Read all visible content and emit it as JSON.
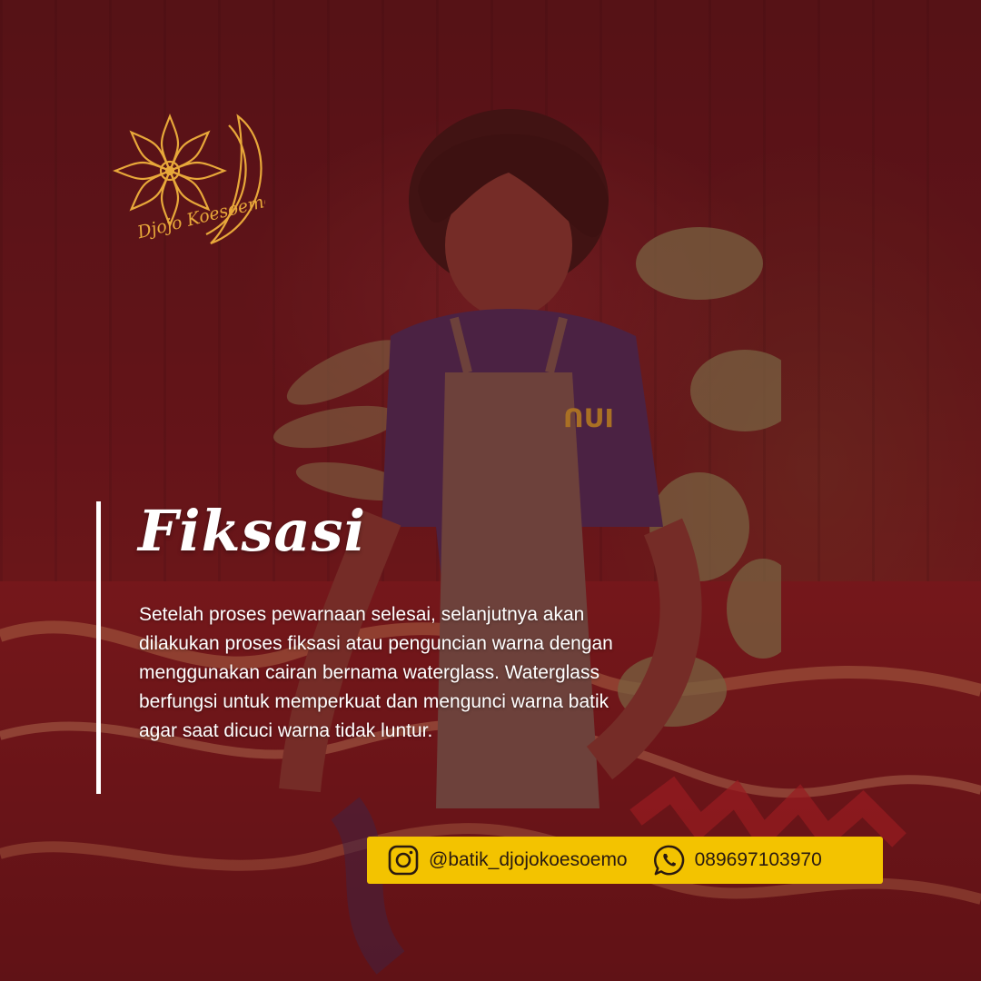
{
  "brand": {
    "logo_text": "Djojo Koesoemo"
  },
  "content": {
    "title": "Fiksasi",
    "description": "Setelah proses pewarnaan selesai, selanjutnya akan dilakukan proses fiksasi atau penguncian warna dengan menggunakan cairan bernama waterglass. Waterglass berfungsi untuk memperkuat dan mengunci warna batik agar saat dicuci warna tidak luntur."
  },
  "contact": {
    "instagram_icon": "instagram-icon",
    "instagram_handle": "@batik_djojokoesoemo",
    "whatsapp_icon": "whatsapp-icon",
    "phone": "089697103970"
  },
  "colors": {
    "overlay": "#6e1419",
    "accent_yellow": "#f3c300",
    "logo_gold": "#e8a83a",
    "text": "#ffffff"
  }
}
